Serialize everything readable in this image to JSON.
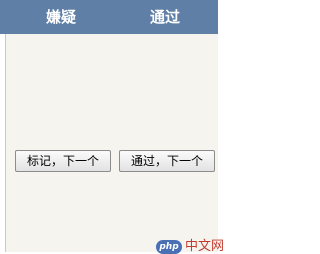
{
  "table": {
    "headers": {
      "suspect": "嫌疑",
      "pass": "通过"
    }
  },
  "actions": {
    "mark_next_label": "标记，下一个",
    "pass_next_label": "通过，下一个"
  },
  "watermark": {
    "logo_text": "php",
    "site_text": "中文网"
  },
  "colors": {
    "header_bg": "#5f7fa6",
    "panel_bg": "#f5f4ef",
    "watermark_red": "#c23b2e"
  }
}
